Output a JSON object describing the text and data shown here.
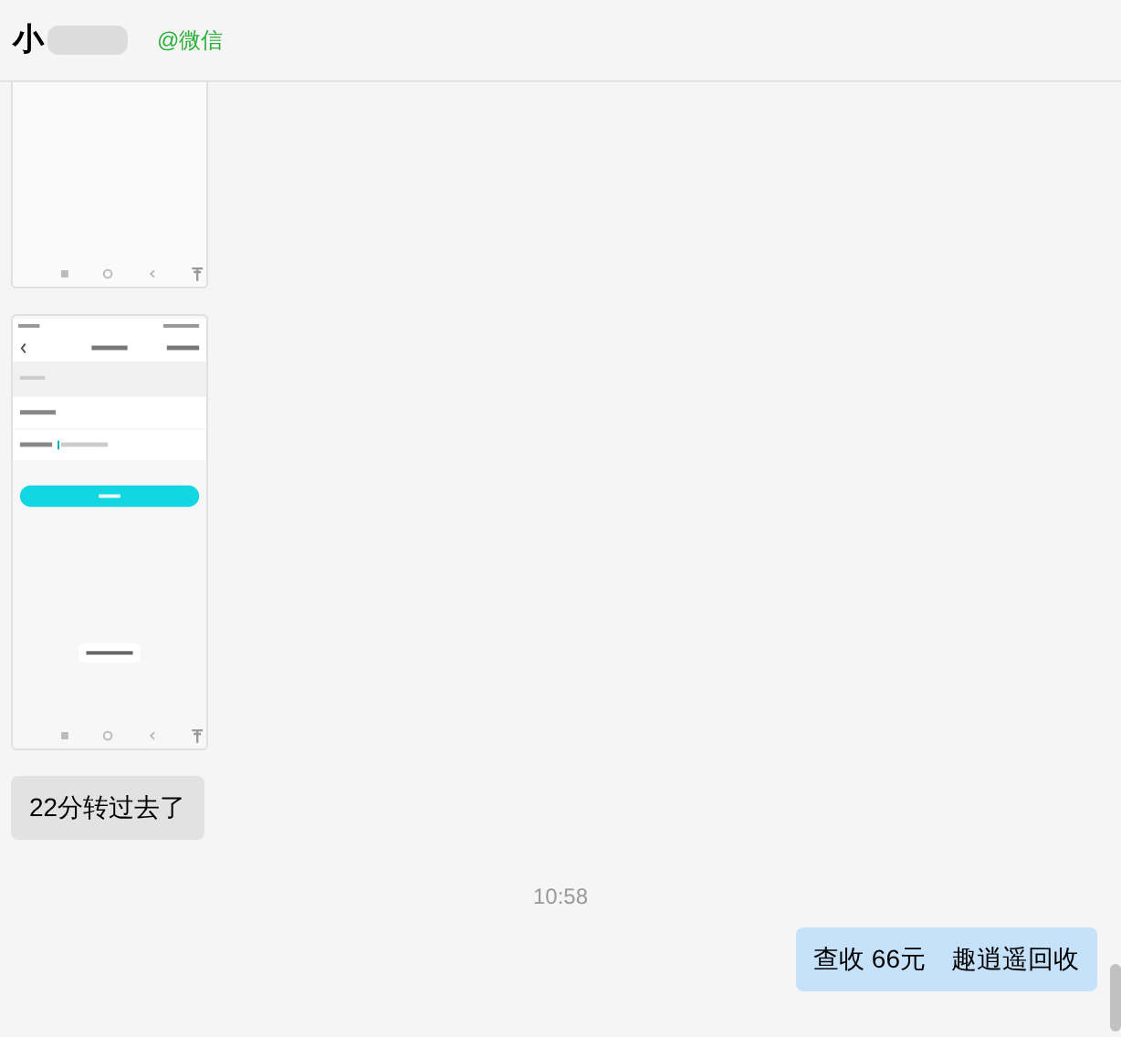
{
  "header": {
    "name": "小",
    "source": "@微信"
  },
  "messages": [
    {
      "kind": "screenshot",
      "outgoing": false,
      "cut": true
    },
    {
      "kind": "screenshot",
      "outgoing": false,
      "cut": false
    },
    {
      "kind": "text",
      "outgoing": false,
      "text": "22分转过去了"
    },
    {
      "kind": "time",
      "text": "10:58"
    },
    {
      "kind": "text",
      "outgoing": true,
      "text": "查收 66元　趣逍遥回收"
    }
  ]
}
